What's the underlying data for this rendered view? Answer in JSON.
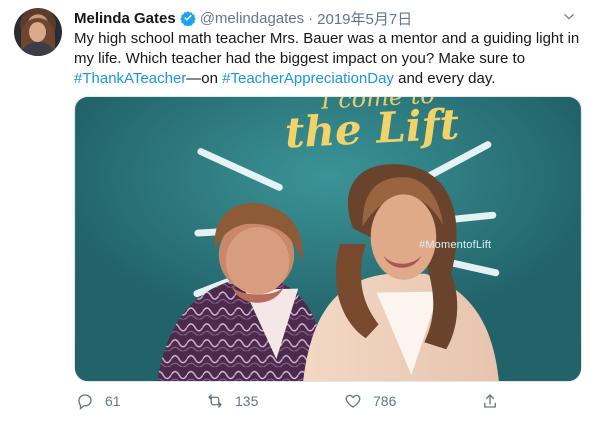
{
  "tweet": {
    "author": {
      "name": "Melinda Gates",
      "handle": "@melindagates",
      "separator": "·",
      "date": "2019年5月7日",
      "verified": true
    },
    "text": {
      "part1": "My high school math teacher Mrs. Bauer was a mentor and a guiding light in my life. Which teacher had the biggest impact on you? Make sure to ",
      "hashtag1": "#ThankATeacher",
      "part2": "—on ",
      "hashtag2": "#TeacherAppreciationDay",
      "part3": " and every day."
    },
    "media": {
      "sign_top": "I come to",
      "sign_title": "the Lift",
      "sign_hashtag": "#MomentofLift"
    },
    "actions": {
      "replies": "61",
      "retweets": "135",
      "likes": "786"
    },
    "icons": {
      "verified": "verified-badge-icon",
      "menu": "chevron-down-icon",
      "reply": "reply-icon",
      "retweet": "retweet-icon",
      "like": "heart-icon",
      "share": "share-icon"
    },
    "colors": {
      "link": "#1b95e0",
      "muted": "#657786",
      "verified": "#1da1f2",
      "media_background": "#2f7d84",
      "sign_text": "#f2d36a"
    }
  }
}
